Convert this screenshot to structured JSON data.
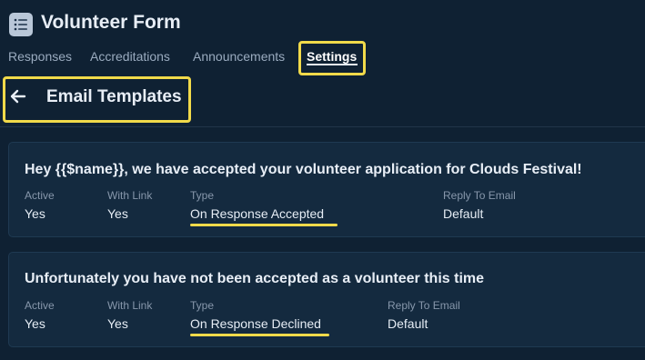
{
  "header": {
    "title": "Volunteer Form",
    "icon": "list-icon"
  },
  "tabs": [
    {
      "label": "Responses"
    },
    {
      "label": "Accreditations"
    },
    {
      "label": "Announcements"
    },
    {
      "label": "Settings",
      "active": true
    }
  ],
  "page": {
    "title": "Email Templates",
    "back_icon": "arrow-left-icon"
  },
  "templates": [
    {
      "title": "Hey {{$name}}, we have accepted your volunteer application for Clouds Festival!",
      "fields": [
        {
          "label": "Active",
          "value": "Yes"
        },
        {
          "label": "With Link",
          "value": "Yes"
        },
        {
          "label": "Type",
          "value": "On Response Accepted"
        },
        {
          "label": "Reply To Email",
          "value": "Default"
        }
      ]
    },
    {
      "title": "Unfortunately you have not been accepted as a volunteer this time",
      "fields": [
        {
          "label": "Active",
          "value": "Yes"
        },
        {
          "label": "With Link",
          "value": "Yes"
        },
        {
          "label": "Type",
          "value": "On Response Declined"
        },
        {
          "label": "Reply To Email",
          "value": "Default"
        }
      ]
    }
  ],
  "colors": {
    "background": "#0f2133",
    "card": "#142a3f",
    "highlight": "#f1da4a"
  }
}
